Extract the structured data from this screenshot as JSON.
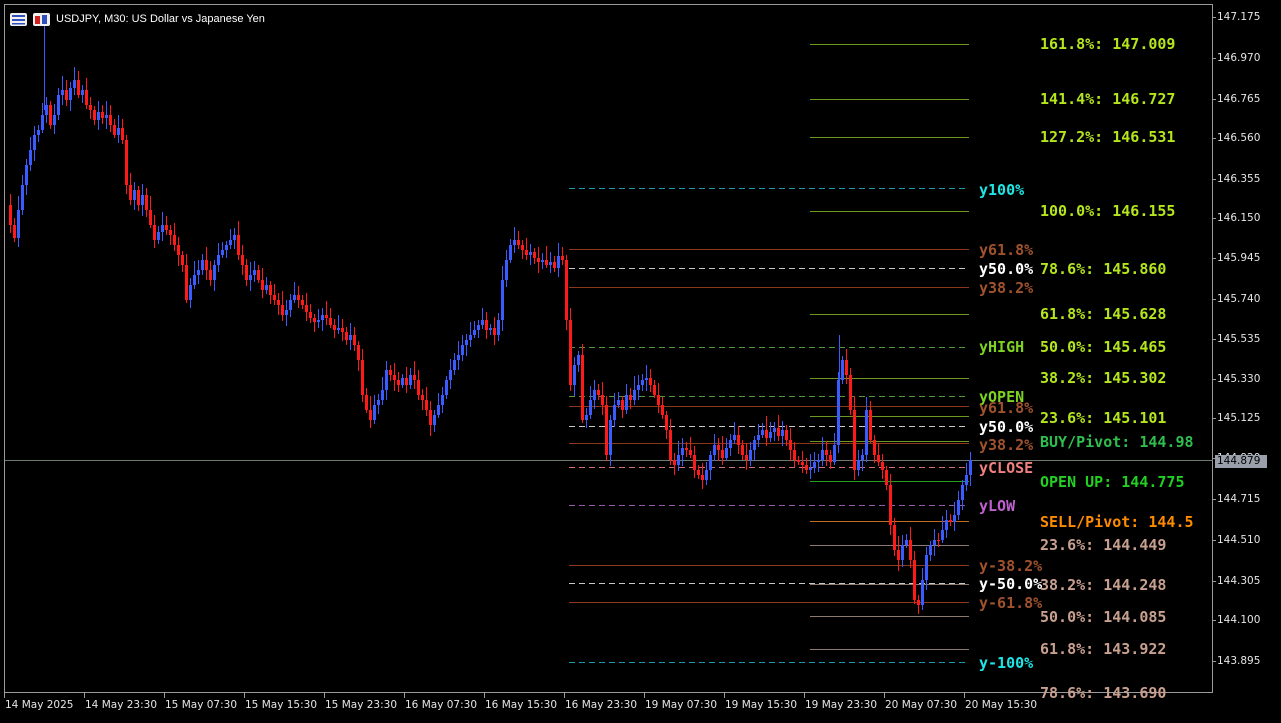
{
  "window": {
    "symbol_title": "USDJPY, M30:  US Dollar vs Japanese Yen"
  },
  "price_axis": {
    "ticks": [
      "147.175",
      "146.970",
      "146.765",
      "146.560",
      "146.355",
      "146.150",
      "145.945",
      "145.740",
      "145.535",
      "145.330",
      "145.125",
      "144.920",
      "144.715",
      "144.510",
      "144.305",
      "144.100",
      "143.895"
    ],
    "current_price": "144.879"
  },
  "time_axis": {
    "ticks": [
      "14 May 2025",
      "14 May 23:30",
      "15 May 07:30",
      "15 May 15:30",
      "15 May 23:30",
      "16 May 07:30",
      "16 May 15:30",
      "16 May 23:30",
      "19 May 07:30",
      "19 May 15:30",
      "19 May 23:30",
      "20 May 07:30",
      "20 May 15:30"
    ]
  },
  "fib_labels": [
    {
      "text": "161.8%: 147.009",
      "color": "#b5e61d"
    },
    {
      "text": "141.4%: 146.727",
      "color": "#b5e61d"
    },
    {
      "text": "127.2%: 146.531",
      "color": "#b5e61d"
    },
    {
      "text": "y100%",
      "color": "#1ee6e6"
    },
    {
      "text": "100.0%: 146.155",
      "color": "#b5e61d"
    },
    {
      "text": "y61.8%",
      "color": "#a0522d"
    },
    {
      "text": "y50.0%",
      "color": "#ffffff"
    },
    {
      "text": "78.6%: 145.860",
      "color": "#b5e61d"
    },
    {
      "text": "y38.2%",
      "color": "#a0522d"
    },
    {
      "text": "61.8%: 145.628",
      "color": "#b5e61d"
    },
    {
      "text": "yHIGH",
      "color": "#7ed321"
    },
    {
      "text": "50.0%: 145.465",
      "color": "#b5e61d"
    },
    {
      "text": "38.2%: 145.302",
      "color": "#b5e61d"
    },
    {
      "text": "yOPEN",
      "color": "#7ed321"
    },
    {
      "text": "y61.8%",
      "color": "#a0522d"
    },
    {
      "text": "23.6%: 145.101",
      "color": "#b5e61d"
    },
    {
      "text": "y50.0%",
      "color": "#ffffff"
    },
    {
      "text": "y38.2%",
      "color": "#a0522d"
    },
    {
      "text": "BUY/Pivot: 144.98",
      "color": "#2fbf4f"
    },
    {
      "text": "yCLOSE",
      "color": "#f08080"
    },
    {
      "text": "OPEN UP: 144.775",
      "color": "#22d022"
    },
    {
      "text": "yLOW",
      "color": "#c060d0"
    },
    {
      "text": "SELL/Pivot: 144.5",
      "color": "#ff8c00"
    },
    {
      "text": "23.6%: 144.449",
      "color": "#c8a090"
    },
    {
      "text": "y-38.2%",
      "color": "#a0522d"
    },
    {
      "text": "y-50.0%",
      "color": "#ffffff"
    },
    {
      "text": "38.2%: 144.248",
      "color": "#c8a090"
    },
    {
      "text": "y-61.8%",
      "color": "#a0522d"
    },
    {
      "text": "50.0%: 144.085",
      "color": "#c8a090"
    },
    {
      "text": "61.8%: 143.922",
      "color": "#c8a090"
    },
    {
      "text": "y-100%",
      "color": "#1ee6e6"
    },
    {
      "text": "78.6%: 143.690",
      "color": "#c8a090"
    }
  ],
  "colors": {
    "bull": "#3a5bff",
    "bear": "#ff1a1a",
    "background": "#000000",
    "frame": "#9a9a9a"
  }
}
